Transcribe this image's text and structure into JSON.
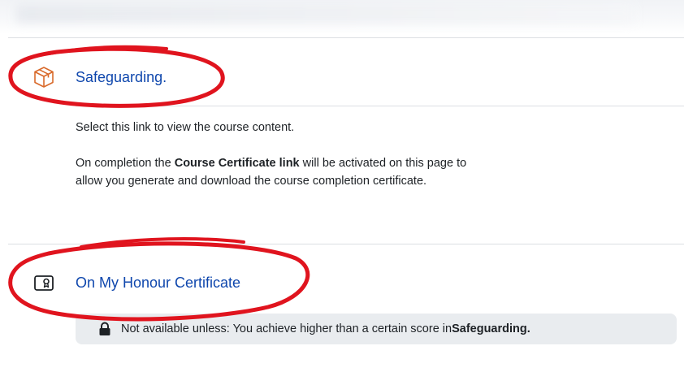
{
  "colors": {
    "link": "#0f47ad",
    "annotation_red": "#e0141e",
    "restriction_bg": "#e9ecef",
    "icon_orange": "#d96a2b"
  },
  "activities": [
    {
      "icon": "package-box-icon",
      "title": "Safeguarding.",
      "description_line1": "Select this link to view the course content.",
      "description_p2_before": "On completion the ",
      "description_p2_bold": "Course Certificate link",
      "description_p2_after": " will be activated on this page to",
      "description_p2_line2": "allow you generate and download the course completion certificate."
    },
    {
      "icon": "certificate-icon",
      "title": "On My Honour Certificate",
      "restriction_prefix": "Not available unless: You achieve higher than a certain score in ",
      "restriction_bold": "Safeguarding."
    }
  ]
}
